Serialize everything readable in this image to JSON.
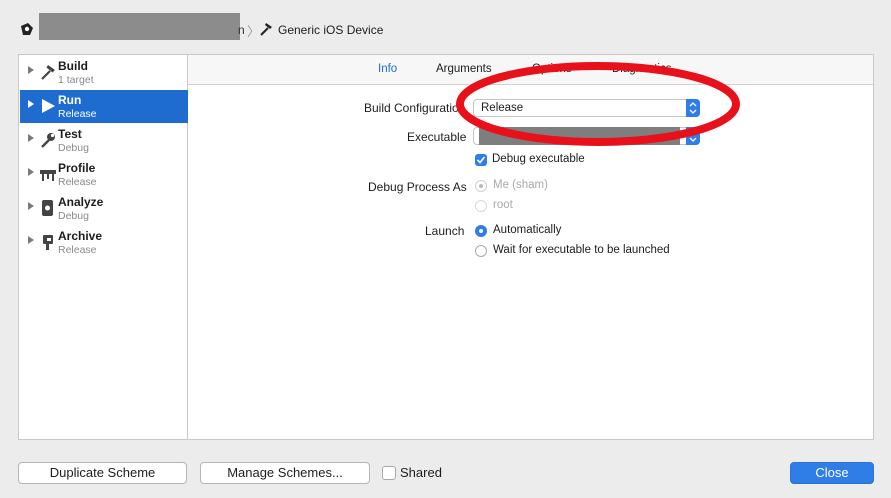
{
  "breadcrumb": {
    "redacted_tail": "n",
    "destination": "Generic iOS Device"
  },
  "sidebar": {
    "items": [
      {
        "title": "Build",
        "subtitle": "1 target",
        "icon": "hammer-icon",
        "selected": false
      },
      {
        "title": "Run",
        "subtitle": "Release",
        "icon": "play-icon",
        "selected": true
      },
      {
        "title": "Test",
        "subtitle": "Debug",
        "icon": "wrench-icon",
        "selected": false
      },
      {
        "title": "Profile",
        "subtitle": "Release",
        "icon": "instruments-icon",
        "selected": false
      },
      {
        "title": "Analyze",
        "subtitle": "Debug",
        "icon": "analyze-icon",
        "selected": false
      },
      {
        "title": "Archive",
        "subtitle": "Release",
        "icon": "archive-icon",
        "selected": false
      }
    ]
  },
  "tabs": [
    {
      "label": "Info",
      "active": true
    },
    {
      "label": "Arguments",
      "active": false
    },
    {
      "label": "Options",
      "active": false
    },
    {
      "label": "Diagnostics",
      "active": false
    }
  ],
  "form": {
    "build_configuration_label": "Build Configuration",
    "build_configuration_value": "Release",
    "executable_label": "Executable",
    "debug_executable_label": "Debug executable",
    "debug_executable_checked": true,
    "debug_process_as_label": "Debug Process As",
    "debug_process_options": [
      "Me (sham)",
      "root"
    ],
    "launch_label": "Launch",
    "launch_options": [
      "Automatically",
      "Wait for executable to be launched"
    ]
  },
  "footer": {
    "duplicate_label": "Duplicate Scheme",
    "manage_label": "Manage Schemes...",
    "shared_label": "Shared",
    "shared_checked": false,
    "close_label": "Close"
  },
  "colors": {
    "accent": "#2f7ee8",
    "selection": "#1f6cd1",
    "annotation": "#e8101a"
  }
}
